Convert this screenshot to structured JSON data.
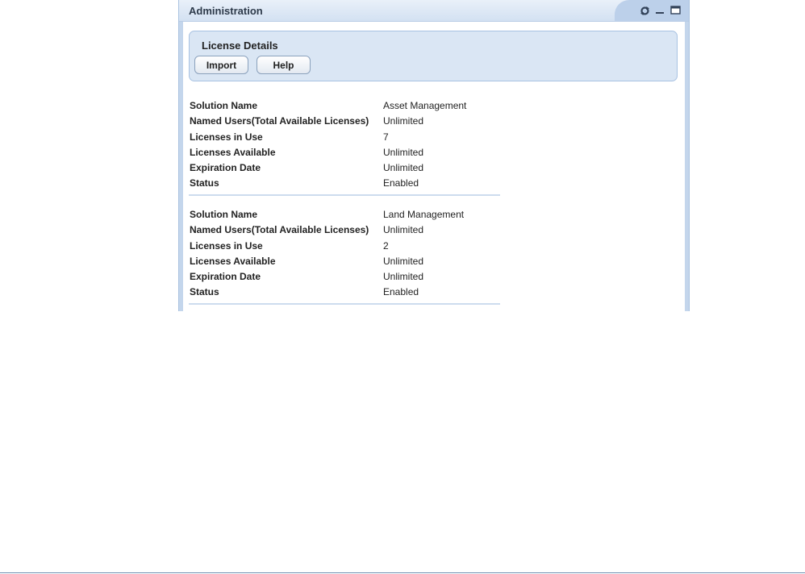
{
  "portlet": {
    "title": "Administration",
    "icons": [
      "refresh-icon",
      "minimize-icon",
      "maximize-icon"
    ]
  },
  "license_details": {
    "title": "License Details",
    "buttons": {
      "import": "Import",
      "help": "Help"
    }
  },
  "licenses": [
    {
      "rows": [
        {
          "label": "Solution Name",
          "value": "Asset Management"
        },
        {
          "label": "Named Users(Total Available Licenses)",
          "value": "Unlimited"
        },
        {
          "label": "Licenses in Use",
          "value": "7"
        },
        {
          "label": "Licenses Available",
          "value": "Unlimited"
        },
        {
          "label": "Expiration Date",
          "value": "Unlimited"
        },
        {
          "label": "Status",
          "value": "Enabled"
        }
      ]
    },
    {
      "rows": [
        {
          "label": "Solution Name",
          "value": "Land Management"
        },
        {
          "label": "Named Users(Total Available Licenses)",
          "value": "Unlimited"
        },
        {
          "label": "Licenses in Use",
          "value": "2"
        },
        {
          "label": "Licenses Available",
          "value": "Unlimited"
        },
        {
          "label": "Expiration Date",
          "value": "Unlimited"
        },
        {
          "label": "Status",
          "value": "Enabled"
        }
      ]
    }
  ]
}
